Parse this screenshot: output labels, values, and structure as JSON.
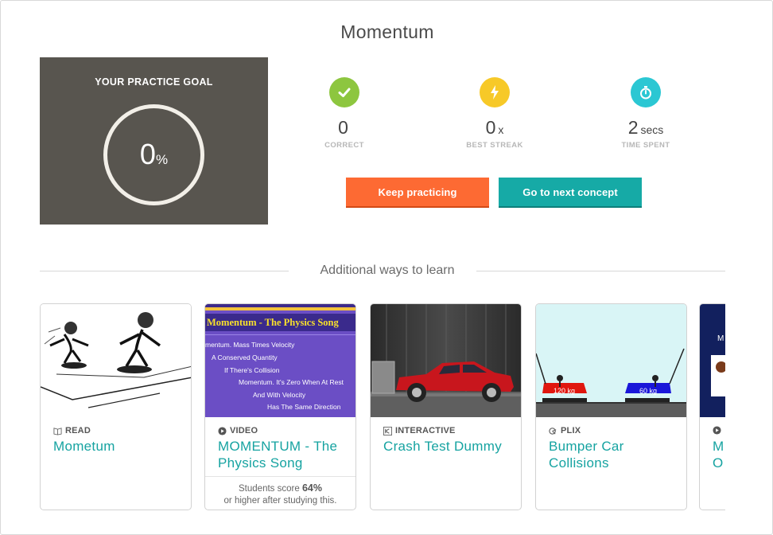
{
  "page": {
    "title": "Momentum"
  },
  "goal": {
    "title": "YOUR PRACTICE GOAL",
    "value": "0",
    "unit": "%",
    "progress_fraction": 0
  },
  "stats": [
    {
      "value": "0",
      "unit": "",
      "label": "CORRECT",
      "icon": "checkmark-icon",
      "color": "#8dc63f"
    },
    {
      "value": "0",
      "unit": "x",
      "label": "BEST STREAK",
      "icon": "lightning-icon",
      "color": "#f7c928"
    },
    {
      "value": "2",
      "unit": "secs",
      "label": "TIME SPENT",
      "icon": "stopwatch-icon",
      "color": "#2bc7d3"
    }
  ],
  "buttons": {
    "keep": "Keep practicing",
    "next": "Go to next concept"
  },
  "colors": {
    "accent_orange": "#fd6a33",
    "accent_teal": "#16aaa6",
    "link_teal": "#16a3a1",
    "goal_bg": "#58554f"
  },
  "section": {
    "heading": "Additional ways to learn"
  },
  "cards": [
    {
      "type": "READ",
      "icon": "book-icon",
      "title": "Mometum",
      "footer": null
    },
    {
      "type": "VIDEO",
      "icon": "play-icon",
      "title": "MOMENTUM - The Physics Song",
      "thumb_banner": "Momentum - The Physics Song",
      "thumb_lines": [
        "mentum. Mass Times Velocity",
        "A Conserved Quantity",
        "If There's Collision",
        "Momentum. It's Zero When At Rest",
        "And With Velocity",
        "Has The Same Direction"
      ],
      "footer": {
        "pre": "Students score",
        "score": "64%",
        "post": "or higher after studying this."
      }
    },
    {
      "type": "INTERACTIVE",
      "icon": "interactive-icon",
      "title": "Crash Test Dummy",
      "footer": null
    },
    {
      "type": "PLIX",
      "icon": "plix-icon",
      "title": "Bumper Car Collisions",
      "thumb_labels": [
        "120 kg",
        "60 kg"
      ],
      "footer": null
    },
    {
      "type": "",
      "icon": "play-icon",
      "title": "M\nO",
      "thumb_text": "M",
      "footer": null
    }
  ]
}
